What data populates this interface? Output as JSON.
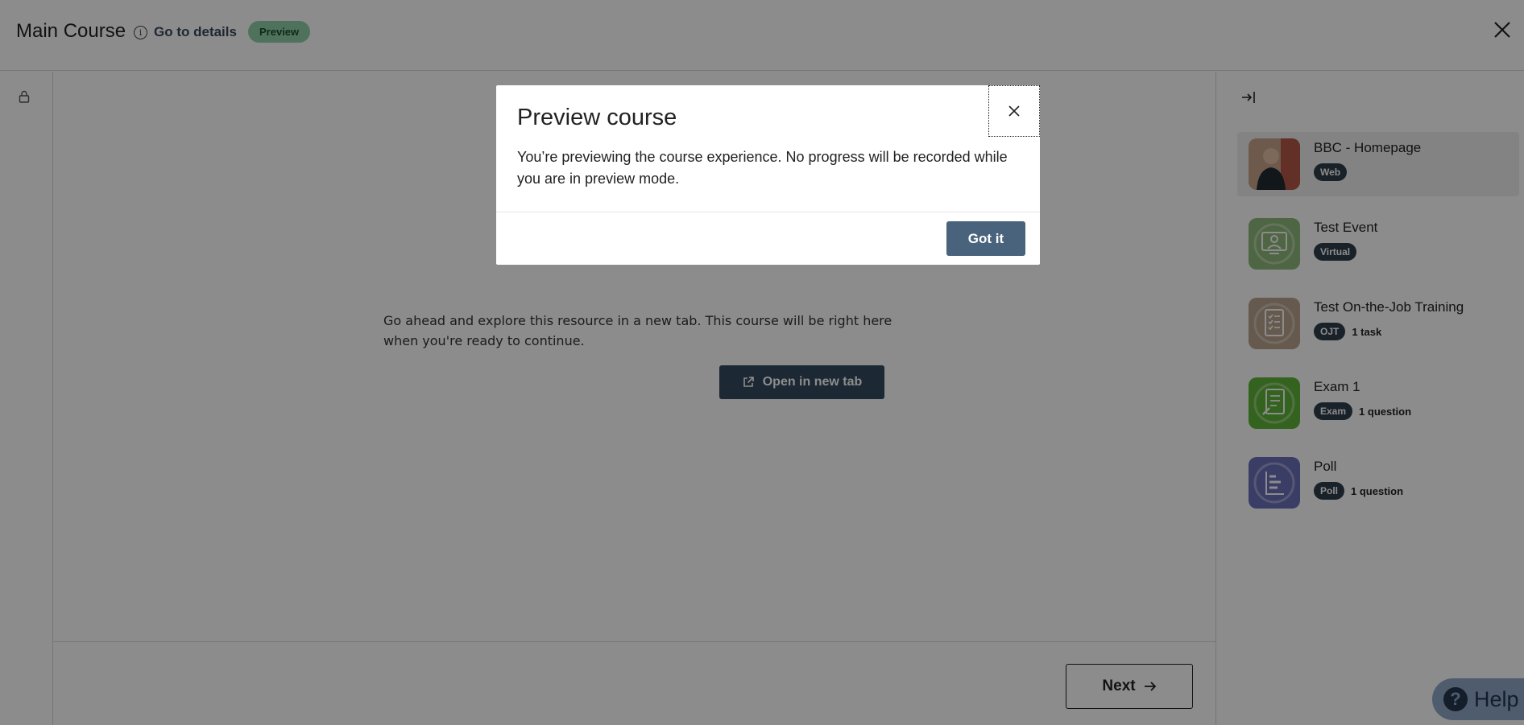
{
  "header": {
    "title": "Main Course",
    "details_link": "Go to details",
    "status_badge": "Preview"
  },
  "content": {
    "message": "Go ahead and explore this resource in a new tab. This course will be right here when you're ready to continue.",
    "open_button": "Open in new tab"
  },
  "footer": {
    "next_label": "Next"
  },
  "sidebar": {
    "items": [
      {
        "title": "BBC - Homepage",
        "type": "Web",
        "meta": "",
        "icon": "photo-thumbnail",
        "color": "#b56a55"
      },
      {
        "title": "Test Event",
        "type": "Virtual",
        "meta": "",
        "icon": "presenter-icon",
        "color": "#8fbb7a"
      },
      {
        "title": "Test On-the-Job Training",
        "type": "OJT",
        "meta": "1 task",
        "icon": "checklist-icon",
        "color": "#b9a48c"
      },
      {
        "title": "Exam 1",
        "type": "Exam",
        "meta": "1 question",
        "icon": "exam-icon",
        "color": "#5fb43a"
      },
      {
        "title": "Poll",
        "type": "Poll",
        "meta": "1 question",
        "icon": "poll-icon",
        "color": "#6a6fb8"
      }
    ]
  },
  "help": {
    "label": "Help"
  },
  "modal": {
    "title": "Preview course",
    "body": "You’re previewing the course experience. No progress will be recorded while you are in preview mode.",
    "confirm_label": "Got it"
  }
}
